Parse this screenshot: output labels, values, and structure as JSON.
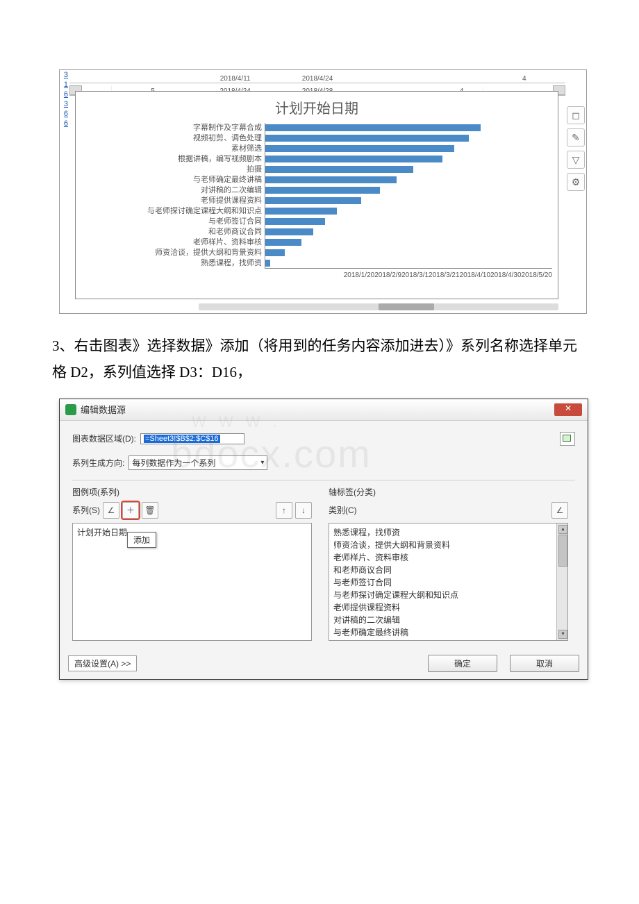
{
  "instruction_text": "3、右击图表》选择数据》添加（将用到的任务内容添加进去）》系列名称选择单元格 D2，系列值选择 D3：D16，",
  "left_ruler": [
    "3",
    "1",
    "6",
    "3",
    "6",
    "6"
  ],
  "top_ruler": {
    "cell1": "5",
    "date_a": "2018/4/11",
    "date_b": "2018/4/24",
    "date_c": "2018/4/24",
    "date_d": "2018/4/28",
    "cell2": "4",
    "cell3": "4"
  },
  "chart_data": {
    "type": "bar",
    "title": "计划开始日期",
    "categories": [
      "字幕制作及字幕合成",
      "视频初剪、调色处理",
      "素材筛选",
      "根据讲稿，编写视频剧本",
      "拍摄",
      "与老师确定最终讲稿",
      "对讲稿的二次编辑",
      "老师提供课程资料",
      "与老师探讨确定课程大纲和知识点",
      "与老师签订合同",
      "和老师商议合同",
      "老师样片、资料审核",
      "师资洽谈，提供大纲和背景资料",
      "熟悉课程，找师资"
    ],
    "values": [
      43210,
      43205,
      43199,
      43194,
      43182,
      43175,
      43168,
      43160,
      43150,
      43145,
      43140,
      43135,
      43128,
      43122
    ],
    "xticks": [
      "2018/1/20",
      "2018/2/9",
      "2018/3/1",
      "2018/3/21",
      "2018/4/10",
      "2018/4/30",
      "2018/5/20"
    ],
    "xlim": [
      43120,
      43240
    ]
  },
  "side_icons": [
    "◻",
    "✎",
    "▽",
    "⚙"
  ],
  "dialog": {
    "title": "编辑数据源",
    "range_label": "图表数据区域(D):",
    "range_value": "=Sheet3!$B$2:$C$16",
    "dir_label": "系列生成方向:",
    "dir_value": "每列数据作为一个系列",
    "left_head": "图例项(系列)",
    "right_head": "轴标签(分类)",
    "series_label": "系列(S)",
    "category_label": "类别(C)",
    "series_items": [
      "计划开始日期"
    ],
    "add_tooltip": "添加",
    "category_items": [
      "熟悉课程，找师资",
      "师资洽谈，提供大纲和背景资料",
      "老师样片、资料审核",
      "和老师商议合同",
      "与老师签订合同",
      "与老师探讨确定课程大纲和知识点",
      "老师提供课程资料",
      "对讲稿的二次编辑",
      "与老师确定最终讲稿"
    ],
    "advanced": "高级设置(A) >>",
    "ok": "确定",
    "cancel": "取消",
    "close_icon": "✕"
  },
  "watermark_main": "bdocx.com",
  "watermark_sub": "W W W ."
}
